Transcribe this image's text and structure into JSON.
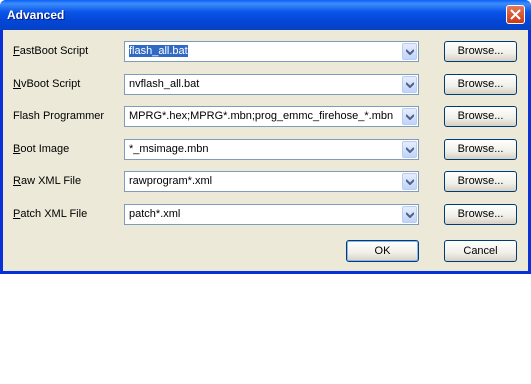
{
  "window": {
    "title": "Advanced"
  },
  "rows": [
    {
      "label_key": "F",
      "label_rest": "astBoot Script",
      "value": "flash_all.bat",
      "browse": "Browse..."
    },
    {
      "label_key": "N",
      "label_rest": "vBoot Script",
      "value": "nvflash_all.bat",
      "browse": "Browse..."
    },
    {
      "label_key": "",
      "label_rest": "Flash Programmer",
      "value": "MPRG*.hex;MPRG*.mbn;prog_emmc_firehose_*.mbn",
      "browse": "Browse..."
    },
    {
      "label_key": "B",
      "label_rest": "oot Image",
      "value": "*_msimage.mbn",
      "browse": "Browse..."
    },
    {
      "label_key": "R",
      "label_rest": "aw XML File",
      "value": "rawprogram*.xml",
      "browse": "Browse..."
    },
    {
      "label_key": "P",
      "label_rest": "atch XML File",
      "value": "patch*.xml",
      "browse": "Browse..."
    }
  ],
  "buttons": {
    "ok": "OK",
    "cancel": "Cancel"
  }
}
